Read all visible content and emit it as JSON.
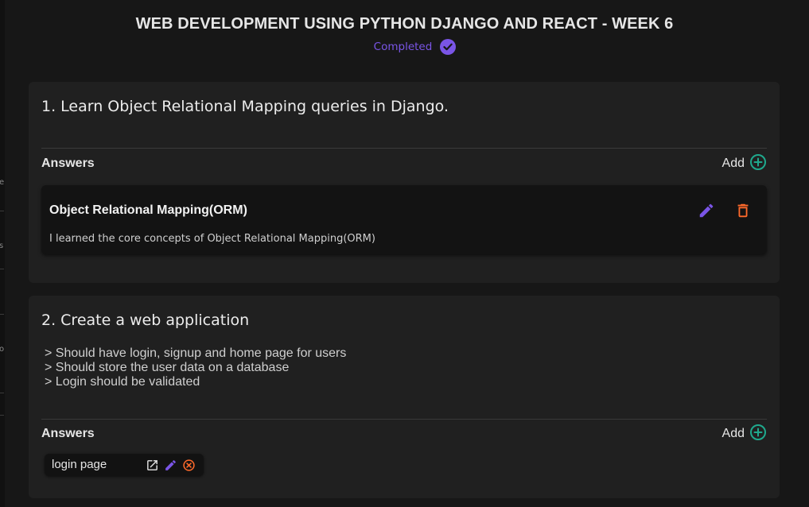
{
  "page": {
    "title": "WEB DEVELOPMENT USING PYTHON DJANGO AND REACT - WEEK 6",
    "status": "Completed"
  },
  "colors": {
    "accent_purple": "#7a55e6",
    "accent_teal": "#1fa98d",
    "danger_orange": "#ff6a2b",
    "card_bg": "#202020",
    "page_bg": "#171717"
  },
  "questions": [
    {
      "title": "1. Learn Object Relational Mapping queries in Django.",
      "description_lines": [],
      "answers_label": "Answers",
      "add_label": "Add",
      "answers": [
        {
          "title": "Object Relational Mapping(ORM)",
          "description": "I learned the core concepts of Object Relational Mapping(ORM)"
        }
      ]
    },
    {
      "title": "2. Create a web application",
      "description_lines": [
        "> Should have login, signup and home page for users",
        "> Should store the user data on a database",
        "> Login should be validated"
      ],
      "answers_label": "Answers",
      "add_label": "Add",
      "links": [
        {
          "label": "login page"
        }
      ]
    }
  ],
  "icons": {
    "status": "check-circle-icon",
    "add": "plus-circle-icon",
    "edit": "pencil-icon",
    "delete": "trash-icon",
    "open": "external-link-icon",
    "remove": "close-circle-icon"
  }
}
